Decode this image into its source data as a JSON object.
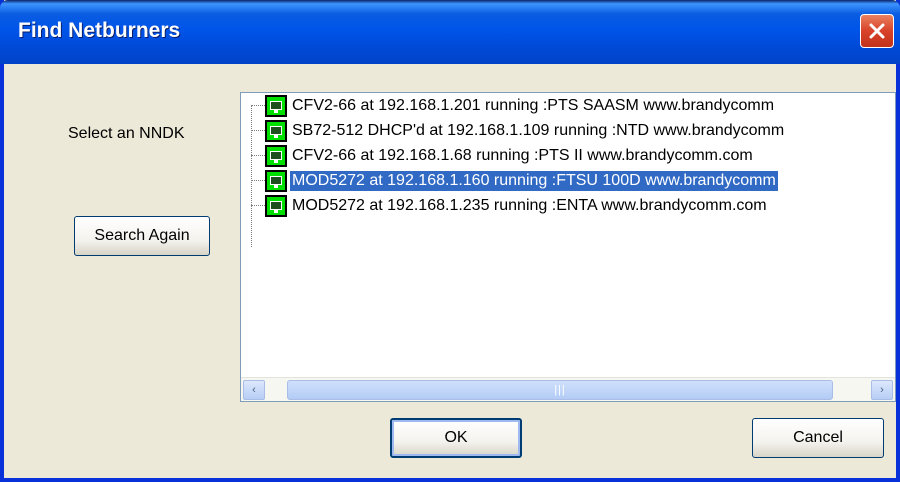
{
  "window": {
    "title": "Find Netburners",
    "close_icon": "close-icon"
  },
  "left_panel": {
    "select_label": "Select an NNDK",
    "search_again_label": "Search Again"
  },
  "device_list": {
    "selected_index": 3,
    "items": [
      {
        "label": "CFV2-66  at 192.168.1.201 running :PTS SAASM www.brandycomm"
      },
      {
        "label": "SB72-512 DHCP'd at 192.168.1.109 running :NTD www.brandycomm"
      },
      {
        "label": "CFV2-66  at 192.168.1.68 running :PTS II www.brandycomm.com"
      },
      {
        "label": "MOD5272  at 192.168.1.160 running :FTSU 100D www.brandycomm"
      },
      {
        "label": "MOD5272  at 192.168.1.235 running :ENTA www.brandycomm.com"
      }
    ],
    "scrollbar": {
      "left_arrow": "‹",
      "right_arrow": "›",
      "grip": "|||"
    }
  },
  "buttons": {
    "ok_label": "OK",
    "cancel_label": "Cancel"
  },
  "colors": {
    "titlebar": "#0055ea",
    "selection": "#316ac5",
    "dialog_bg": "#ece9d8",
    "device_icon": "#00e000"
  }
}
